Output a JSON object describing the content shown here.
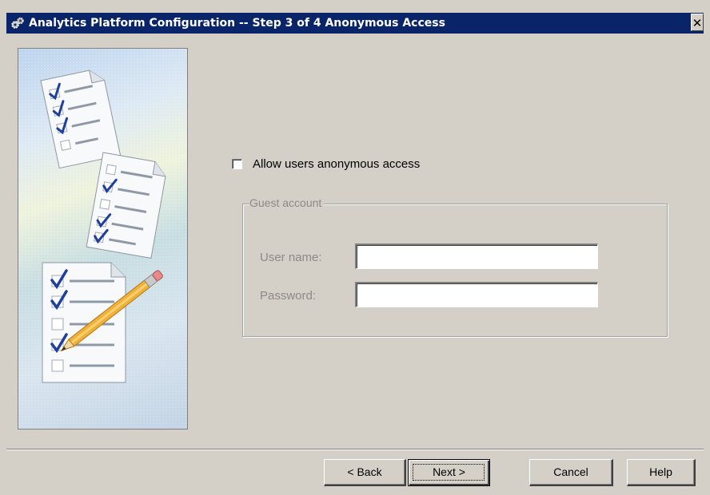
{
  "window": {
    "title": "Analytics Platform Configuration  -- Step 3 of 4  Anonymous Access",
    "app_icon": "gears-icon",
    "close_label": "✕"
  },
  "sidebar": {
    "illustration": "checklist-documents-with-pencil"
  },
  "anonymous": {
    "checkbox_label": "Allow users anonymous access",
    "checked": false
  },
  "guest_account": {
    "legend": "Guest account",
    "username_label": "User name:",
    "username_value": "",
    "password_label": "Password:",
    "password_value": "",
    "enabled": false
  },
  "buttons": {
    "back": "< Back",
    "next": "Next >",
    "cancel": "Cancel",
    "help": "Help"
  }
}
